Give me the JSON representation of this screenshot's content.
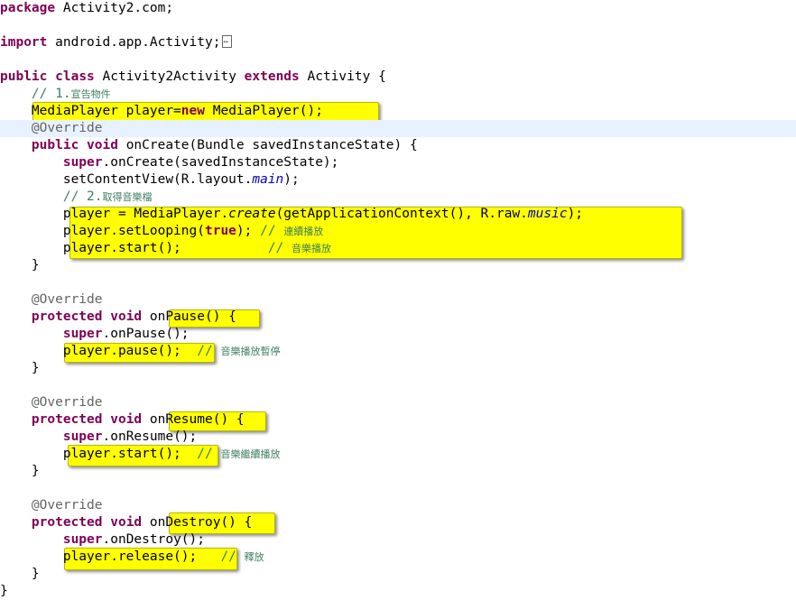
{
  "lines": {
    "l0": {
      "kw": "package",
      "txt": " Activity2.com;"
    },
    "l2": {
      "kw": "import",
      "txt": " android.app.Activity;"
    },
    "l4": {
      "kw1": "public",
      "kw2": "class",
      "name": "Activity2Activity",
      "kw3": "extends",
      "txt": " Activity {"
    },
    "l5": {
      "cm": "// 1.",
      "zh": "宣告物件"
    },
    "l6": {
      "txt": "MediaPlayer player=",
      "kw": "new",
      "txt2": " MediaPlayer();"
    },
    "l7": {
      "an": "@Override"
    },
    "l8": {
      "kw1": "public",
      "kw2": "void",
      "txt": " onCreate(Bundle savedInstanceState) {"
    },
    "l9": {
      "kw": "super",
      "txt": ".onCreate(savedInstanceState);"
    },
    "l10": {
      "txt": "setContentView(R.layout.",
      "it": "main",
      "txt2": ");"
    },
    "l11": {
      "cm": "// 2.",
      "zh": "取得音樂檔"
    },
    "l12": {
      "txt": "player = MediaPlayer.",
      "it": "create",
      "txt2": "(getApplicationContext(), R.raw.",
      "it2": "music",
      "txt3": ");"
    },
    "l13": {
      "txt": "player.setLooping(",
      "kw": "true",
      "txt2": "); ",
      "cm": "// ",
      "zh": "連續播放"
    },
    "l14": {
      "txt": "player.start();           ",
      "cm": "// ",
      "zh": "音樂播放"
    },
    "l15": {
      "txt": "}"
    },
    "l17": {
      "an": "@Override"
    },
    "l18": {
      "kw1": "protected",
      "kw2": "void",
      "txt": " onPause() {"
    },
    "l19": {
      "kw": "super",
      "txt": ".onPause();"
    },
    "l20": {
      "txt": "player.pause();  ",
      "cm": "// ",
      "zh": "音樂播放暫停"
    },
    "l21": {
      "txt": "}"
    },
    "l23": {
      "an": "@Override"
    },
    "l24": {
      "kw1": "protected",
      "kw2": "void",
      "txt": " onResume() {"
    },
    "l25": {
      "kw": "super",
      "txt": ".onResume();"
    },
    "l26": {
      "txt": "player.start();  ",
      "cm": "// ",
      "zh": "音樂繼續播放"
    },
    "l27": {
      "txt": "}"
    },
    "l29": {
      "an": "@Override"
    },
    "l30": {
      "kw1": "protected",
      "kw2": "void",
      "txt": " onDestroy() {"
    },
    "l31": {
      "kw": "super",
      "txt": ".onDestroy();"
    },
    "l32": {
      "txt": "player.release();   ",
      "cm": "// ",
      "zh": "釋放"
    },
    "l33": {
      "txt": "}"
    },
    "l34": {
      "txt": "}"
    }
  },
  "colors": {
    "keyword": "#7f0055",
    "comment": "#3f7f5f",
    "annotation": "#646464",
    "highlight": "#ffff00",
    "current_line": "#e8f2fe"
  }
}
